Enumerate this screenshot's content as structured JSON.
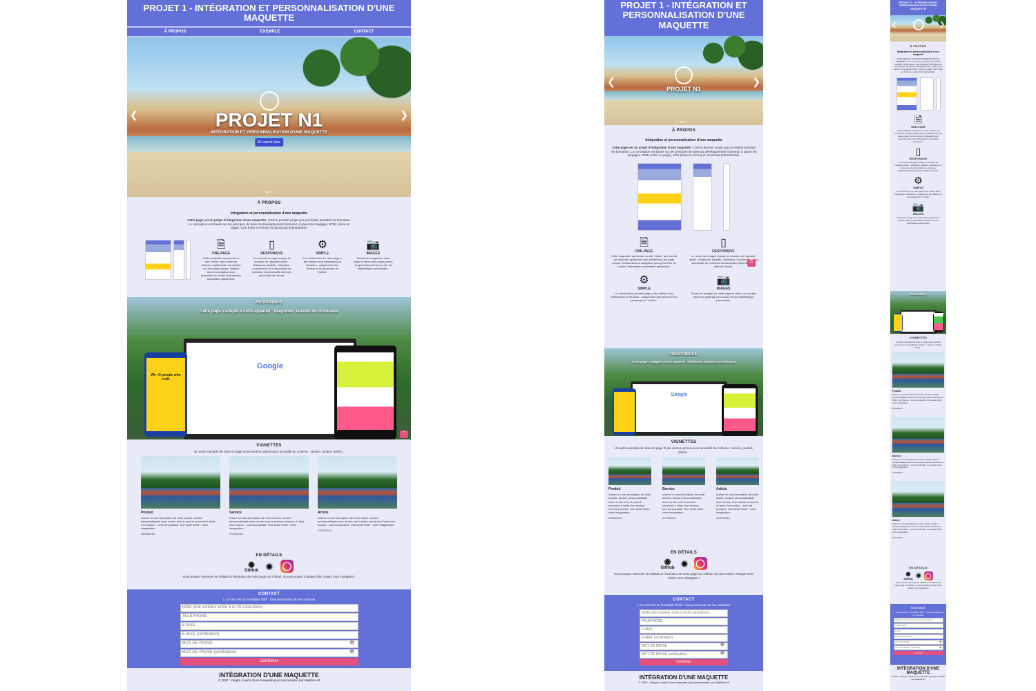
{
  "site_title": "PROJET 1 - INTÉGRATION ET PERSONNALISATION D'UNE MAQUETTE",
  "nav": [
    "À PROPOS",
    "EXEMPLE",
    "CONTACT"
  ],
  "hero": {
    "title": "PROJET N1",
    "subtitle": "INTÉGRATION ET PERSONNALISATION D'UNE MAQUETTE",
    "button": "En savoir plus"
  },
  "about": {
    "title": "À PROPOS",
    "subtitle": "Intégration et personnalisation d'une maquette",
    "text_bold": "Cette page est un projet d'intégration d'une maquette.",
    "text": " C'est le premier projet que j'ai réalisé pendant ma formation. La conception est basée sur les principes de base du développement front-end, à savoir les langages HTML (mise en page), CSS (mise en forme) et Javascript (intéractivité).",
    "features": [
      {
        "name": "ONE-PAGE",
        "icon": "file-icon",
        "text": "Cette maquette représente un site \"vitrine\" qui permet de résumer rapidement une activité sur une page unique, limitant ainsi la navigation pour permettre de rendre l'information accessible rapidement."
      },
      {
        "name": "RESPONSIVE",
        "icon": "phone-icon",
        "text": "Le rendu de la page change en fonction de l'appareil utilisé : téléphone, tablette, ordinateur. La présence et la disposition de certaines fonctionnalité dépends de la taille de l'écran."
      },
      {
        "name": "SIMPLE",
        "icon": "gear-icon",
        "text": "La construction de cette page a été réalisé sans frameworks ni librairies : uniquement des flexbox et du javascript de \"vanilla\"."
      },
      {
        "name": "IMAGES",
        "icon": "camera-icon",
        "text": "Toutes les images sur cette page ici dans mes projets perso en général) sont issues de ma bibliothèque personnelle."
      }
    ]
  },
  "responsive": {
    "title": "RESPONSIVE",
    "subtitle": "Cette page s'adapte à votre appareil : téléphone, tablette ou ordinateur",
    "google": "Google",
    "phone_text": "We <3 people who code"
  },
  "vignettes": {
    "title": "VIGNETTES",
    "subtitle": "Un autre exemple de mise en page d'une section prévue pour accueillir du contenu : service, produit, article...",
    "cards": [
      {
        "title": "Produit",
        "text": "Insérer ici une description de votre produit, section personnalisable avec un lien vers le produit concerné à l'aide d'un bouton... tout est possible. Une seule limite : votre imagination.",
        "date": "23/09/2014"
      },
      {
        "title": "Service",
        "text": "Insérer ici une description de votre service, section personnalisable avec un lien vers le service concerné à l'aide d'un bouton... tout est possible. Une seule limite : votre imagination.",
        "date": "27/09/2014"
      },
      {
        "title": "Article",
        "text": "Insérer ici une description de votre article, section personnalisable avec un lien vers l'article concerné à l'aide d'un bouton... tout est possible. Une seule limite : votre imagination.",
        "date": "21/10/2014"
      }
    ]
  },
  "details": {
    "title": "EN DÉTAILS",
    "github": "GitHub",
    "text": "Vous pouvez retrouver les détails et l'évolution de cette page sur Github. Si vous voulez changer d'air, visitez mon Instagram !"
  },
  "contact": {
    "title": "CONTACT",
    "warning": "⚠ Ce ceci est un formulaire 'fictif' : il ne permet pas de me contacter.",
    "fields": [
      "NOM (doit contenir entre 5 et 20 caractères)",
      "TELEPHONE",
      "E-MAIL",
      "E-MAIL (vérification)",
      "MOT DE PASSE",
      "MOT DE PASSE (vérification)"
    ],
    "submit": "Confirmer"
  },
  "footer": {
    "title": "INTÉGRATION D'UNE MAQUETTE",
    "copy": "© 2020 : Intégré à partir d'une maquette puis personnalisé par Matthieu M"
  },
  "colors": {
    "primary": "#6370d8",
    "background": "#e9eaf8",
    "accent": "#e3507d"
  }
}
